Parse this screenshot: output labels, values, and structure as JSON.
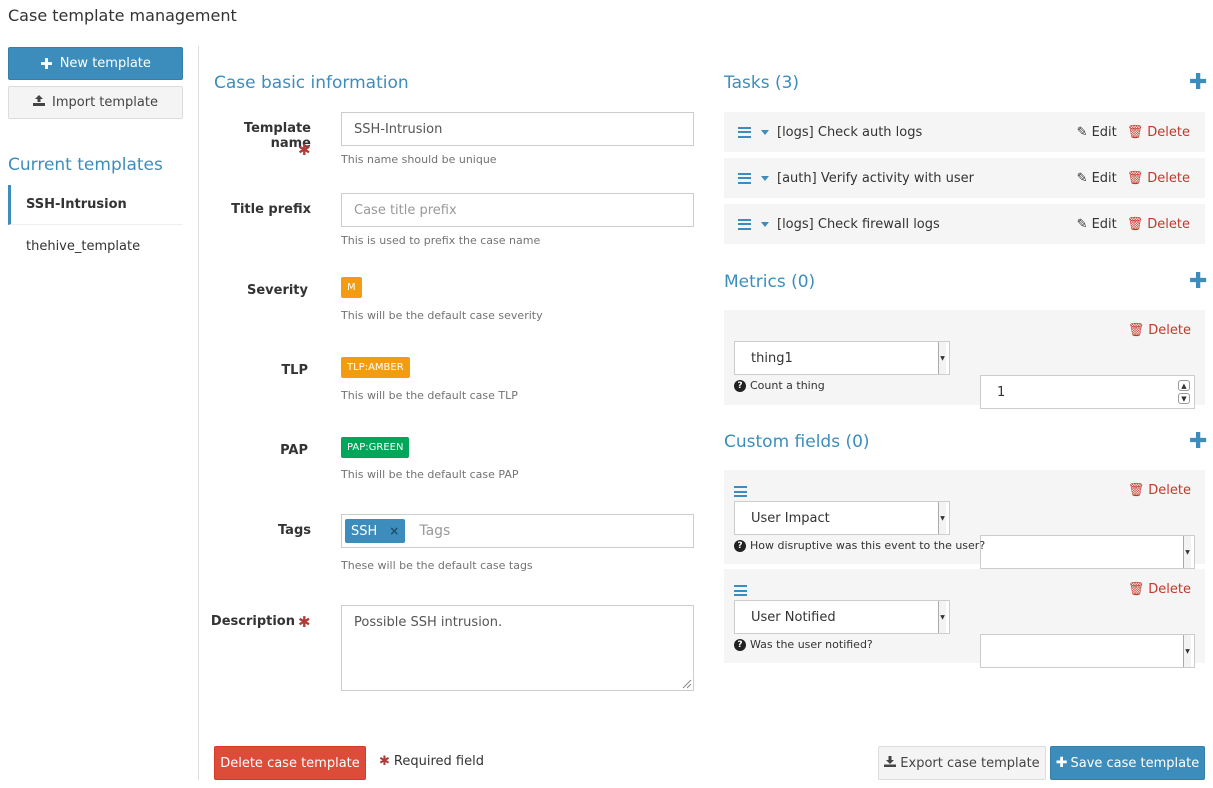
{
  "page": {
    "title": "Case template management"
  },
  "sidebar": {
    "new_template": "New template",
    "import_template": "Import template",
    "current_heading": "Current templates",
    "templates": [
      "SSH-Intrusion",
      "thehive_template"
    ]
  },
  "basic": {
    "heading": "Case basic information",
    "template_name": {
      "label": "Template name",
      "value": "SSH-Intrusion",
      "help": "This name should be unique"
    },
    "title_prefix": {
      "label": "Title prefix",
      "placeholder": "Case title prefix",
      "help": "This is used to prefix the case name"
    },
    "severity": {
      "label": "Severity",
      "value": "M",
      "help": "This will be the default case severity",
      "color": "#f39c12"
    },
    "tlp": {
      "label": "TLP",
      "value": "TLP:AMBER",
      "help": "This will be the default case TLP",
      "color": "#f39c12"
    },
    "pap": {
      "label": "PAP",
      "value": "PAP:GREEN",
      "help": "This will be the default case PAP",
      "color": "#00a65a"
    },
    "tags": {
      "label": "Tags",
      "items": [
        "SSH"
      ],
      "placeholder": "Tags",
      "help": "These will be the default case tags"
    },
    "description": {
      "label": "Description",
      "value": "Possible SSH intrusion."
    }
  },
  "tasks": {
    "heading": "Tasks (3)",
    "edit_label": "Edit",
    "delete_label": "Delete",
    "items": [
      "[logs] Check auth logs",
      "[auth] Verify activity with user",
      "[logs] Check firewall logs"
    ]
  },
  "metrics": {
    "heading": "Metrics (0)",
    "delete_label": "Delete",
    "items": [
      {
        "name": "thing1",
        "value": "1",
        "help": "Count a thing"
      }
    ]
  },
  "custom_fields": {
    "heading": "Custom fields (0)",
    "delete_label": "Delete",
    "items": [
      {
        "name": "User Impact",
        "value": "",
        "help": "How disruptive was this event to the user?"
      },
      {
        "name": "User Notified",
        "value": "",
        "help": "Was the user notified?"
      }
    ]
  },
  "footer": {
    "delete_template": "Delete case template",
    "required_note": "Required field",
    "export_template": "Export case template",
    "save_template": "Save case template"
  },
  "colors": {
    "accent": "#3c8dbc",
    "danger": "#dd4b39"
  }
}
